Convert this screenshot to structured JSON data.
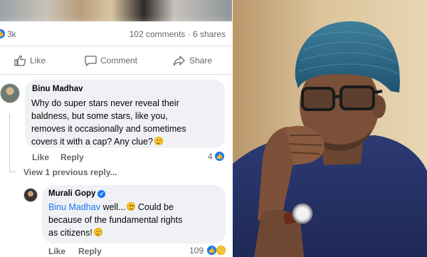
{
  "post": {
    "reactions_count": "3k",
    "comments_shares": "102 comments · 6 shares"
  },
  "actions": {
    "like": "Like",
    "comment": "Comment",
    "share": "Share"
  },
  "comments": [
    {
      "author": "Binu Madhav",
      "lines": [
        "Why do super stars never reveal their",
        "baldness, but some stars, like you,",
        "removes it occasionally and sometimes",
        "covers it with a cap? Any clue?"
      ],
      "like_label": "Like",
      "reply_label": "Reply",
      "like_count": "4"
    }
  ],
  "view_previous": "View 1 previous reply...",
  "reply": {
    "author": "Murali Gopy",
    "mention": "Binu Madhav",
    "line1_rest": " well...",
    "line1_tail": " Could be",
    "line2": "because of the fundamental rights",
    "line3": "as citizens!",
    "like_label": "Like",
    "reply_label": "Reply",
    "like_count": "109"
  },
  "colors": {
    "facebook_blue": "#1877f2",
    "bubble_gray": "#eff1f4",
    "meta_gray": "#65676b"
  },
  "icons": [
    "like-thumb-icon",
    "comment-icon",
    "share-icon",
    "verified-icon",
    "smile-emoji-icon",
    "haha-reaction-icon"
  ]
}
